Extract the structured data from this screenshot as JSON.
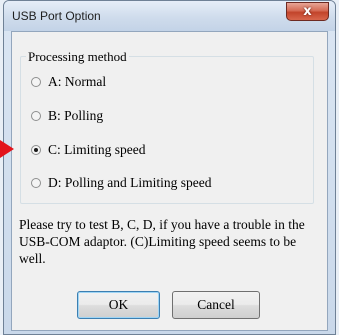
{
  "window": {
    "title": "USB Port Option",
    "close_label": "x"
  },
  "group": {
    "label": "Processing method",
    "options": [
      {
        "label": "A: Normal",
        "selected": false
      },
      {
        "label": "B: Polling",
        "selected": false
      },
      {
        "label": "C: Limiting speed",
        "selected": true
      },
      {
        "label": "D: Polling and Limiting speed",
        "selected": false
      }
    ]
  },
  "info_text": "Please try to test B, C, D, if you have a trouble in the USB-COM adaptor. (C)Limiting speed seems to be well.",
  "buttons": {
    "ok": "OK",
    "cancel": "Cancel"
  },
  "colors": {
    "pointer": "#e3131b",
    "close_button": "#c2442b"
  }
}
